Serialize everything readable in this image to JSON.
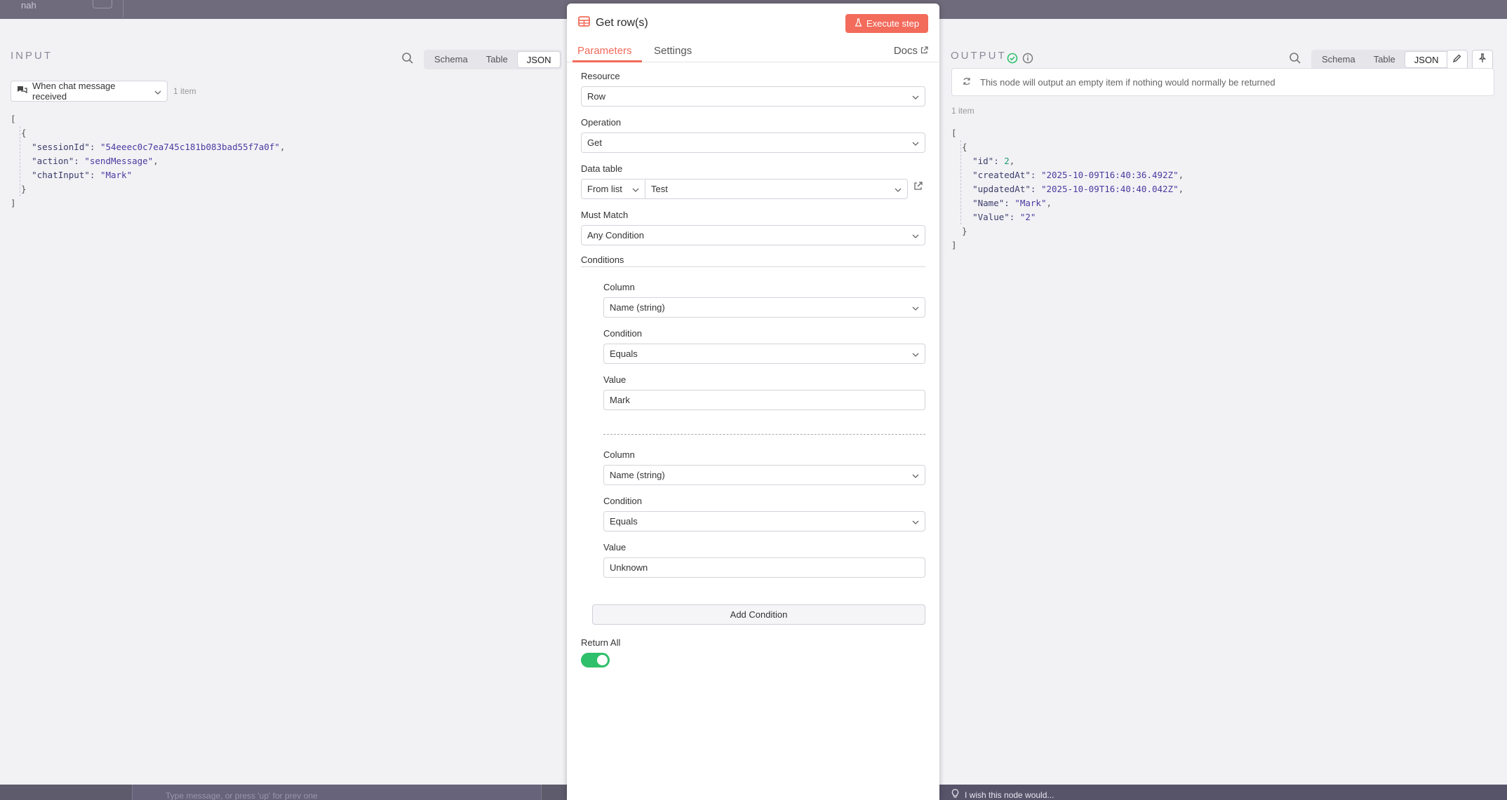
{
  "background_fragment": "nah",
  "input_panel": {
    "title": "INPUT",
    "views": [
      "Schema",
      "Table",
      "JSON"
    ],
    "active_view": "JSON",
    "node_select": "When chat message received",
    "item_count": "1 item",
    "json": {
      "sessionId": "\"54eeec0c7ea745c181b083bad55f7a0f\"",
      "action": "\"sendMessage\"",
      "chatInput": "\"Mark\""
    }
  },
  "modal": {
    "title": "Get row(s)",
    "execute_label": "Execute step",
    "tabs": [
      "Parameters",
      "Settings"
    ],
    "active_tab": "Parameters",
    "docs_label": "Docs",
    "resource": {
      "label": "Resource",
      "value": "Row"
    },
    "operation": {
      "label": "Operation",
      "value": "Get"
    },
    "data_table": {
      "label": "Data table",
      "mode": "From list",
      "value": "Test"
    },
    "must_match": {
      "label": "Must Match",
      "value": "Any Condition"
    },
    "conditions_label": "Conditions",
    "conditions": [
      {
        "column_label": "Column",
        "column": "Name (string)",
        "condition_label": "Condition",
        "condition": "Equals",
        "value_label": "Value",
        "value": "Mark"
      },
      {
        "column_label": "Column",
        "column": "Name (string)",
        "condition_label": "Condition",
        "condition": "Equals",
        "value_label": "Value",
        "value": "Unknown"
      }
    ],
    "add_condition_label": "Add Condition",
    "return_all": {
      "label": "Return All",
      "enabled": true
    }
  },
  "output_panel": {
    "title": "OUTPUT",
    "views": [
      "Schema",
      "Table",
      "JSON"
    ],
    "active_view": "JSON",
    "notice": "This node will output an empty item if nothing would normally be returned",
    "item_count": "1 item",
    "json": {
      "id": "2",
      "createdAt": "\"2025-10-09T16:40:36.492Z\"",
      "updatedAt": "\"2025-10-09T16:40:40.042Z\"",
      "Name": "\"Mark\"",
      "Value": "\"2\""
    }
  },
  "chat": {
    "placeholder": "Type message, or press 'up' for prev one"
  },
  "feedback": {
    "label": "I wish this node would..."
  },
  "colors": {
    "accent": "#f26b5b",
    "success": "#2ec06a",
    "json_string": "#4b3aa0",
    "json_number": "#1f9a6a"
  }
}
